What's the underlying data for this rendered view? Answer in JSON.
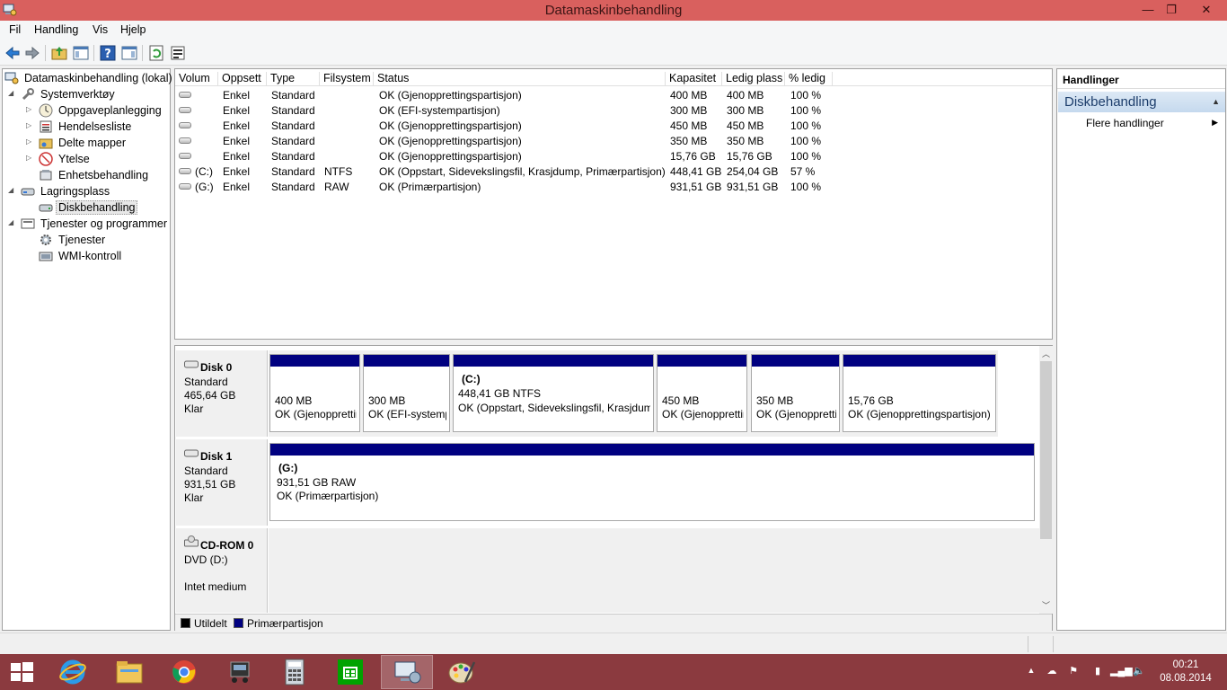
{
  "window": {
    "title": "Datamaskinbehandling",
    "minimize": "—",
    "maximize": "❐",
    "close": "✕"
  },
  "menu": [
    "Fil",
    "Handling",
    "Vis",
    "Hjelp"
  ],
  "tree": {
    "root": "Datamaskinbehandling (lokal)",
    "system_tools": "Systemverktøy",
    "task_scheduler": "Oppgaveplanlegging",
    "event_viewer": "Hendelsesliste",
    "shared_folders": "Delte mapper",
    "performance": "Ytelse",
    "device_manager": "Enhetsbehandling",
    "storage": "Lagringsplass",
    "disk_management": "Diskbehandling",
    "services_apps": "Tjenester og programmer",
    "services": "Tjenester",
    "wmi": "WMI-kontroll"
  },
  "columns": [
    "Volum",
    "Oppsett",
    "Type",
    "Filsystem",
    "Status",
    "Kapasitet",
    "Ledig plass",
    "% ledig"
  ],
  "volumes": [
    {
      "vol": "",
      "layout": "Enkel",
      "type": "Standard",
      "fs": "",
      "status": "OK (Gjenopprettingspartisjon)",
      "cap": "400 MB",
      "free": "400 MB",
      "pct": "100 %"
    },
    {
      "vol": "",
      "layout": "Enkel",
      "type": "Standard",
      "fs": "",
      "status": "OK (EFI-systempartisjon)",
      "cap": "300 MB",
      "free": "300 MB",
      "pct": "100 %"
    },
    {
      "vol": "",
      "layout": "Enkel",
      "type": "Standard",
      "fs": "",
      "status": "OK (Gjenopprettingspartisjon)",
      "cap": "450 MB",
      "free": "450 MB",
      "pct": "100 %"
    },
    {
      "vol": "",
      "layout": "Enkel",
      "type": "Standard",
      "fs": "",
      "status": "OK (Gjenopprettingspartisjon)",
      "cap": "350 MB",
      "free": "350 MB",
      "pct": "100 %"
    },
    {
      "vol": "",
      "layout": "Enkel",
      "type": "Standard",
      "fs": "",
      "status": "OK (Gjenopprettingspartisjon)",
      "cap": "15,76 GB",
      "free": "15,76 GB",
      "pct": "100 %"
    },
    {
      "vol": "(C:)",
      "layout": "Enkel",
      "type": "Standard",
      "fs": "NTFS",
      "status": "OK (Oppstart, Sidevekslingsfil, Krasjdump, Primærpartisjon)",
      "cap": "448,41 GB",
      "free": "254,04 GB",
      "pct": "57 %"
    },
    {
      "vol": "(G:)",
      "layout": "Enkel",
      "type": "Standard",
      "fs": "RAW",
      "status": "OK (Primærpartisjon)",
      "cap": "931,51 GB",
      "free": "931,51 GB",
      "pct": "100 %"
    }
  ],
  "disk0": {
    "name": "Disk 0",
    "kind": "Standard",
    "size": "465,64 GB",
    "state": "Klar",
    "parts": [
      {
        "label": "",
        "size": "400 MB",
        "status": "OK (Gjenopprettingspartisjon)"
      },
      {
        "label": "",
        "size": "300 MB",
        "status": "OK (EFI-systempartisjon)"
      },
      {
        "label": "(C:)",
        "size": "448,41 GB NTFS",
        "status": "OK (Oppstart, Sidevekslingsfil, Krasjdump, Primærpartisjon)"
      },
      {
        "label": "",
        "size": "450 MB",
        "status": "OK (Gjenopprettingspartisjon)"
      },
      {
        "label": "",
        "size": "350 MB",
        "status": "OK (Gjenopprettingspartisjon)"
      },
      {
        "label": "",
        "size": "15,76 GB",
        "status": "OK (Gjenopprettingspartisjon)"
      }
    ]
  },
  "disk1": {
    "name": "Disk 1",
    "kind": "Standard",
    "size": "931,51 GB",
    "state": "Klar",
    "part": {
      "label": "(G:)",
      "size": "931,51 GB RAW",
      "status": "OK (Primærpartisjon)"
    }
  },
  "cdrom": {
    "name": "CD-ROM 0",
    "drive": "DVD (D:)",
    "state": "Intet medium"
  },
  "legend": {
    "unallocated": "Utildelt",
    "primary": "Primærpartisjon",
    "unallocated_color": "#000000",
    "primary_color": "#000080"
  },
  "actions": {
    "header": "Handlinger",
    "section": "Diskbehandling",
    "more": "Flere handlinger"
  },
  "clock": {
    "time": "00:21",
    "date": "08.08.2014"
  },
  "colors": {
    "titlebar": "#d9605e",
    "taskbar": "#8b3a3f",
    "partition_bar": "#000080",
    "action_section": "#c5d9ee"
  }
}
